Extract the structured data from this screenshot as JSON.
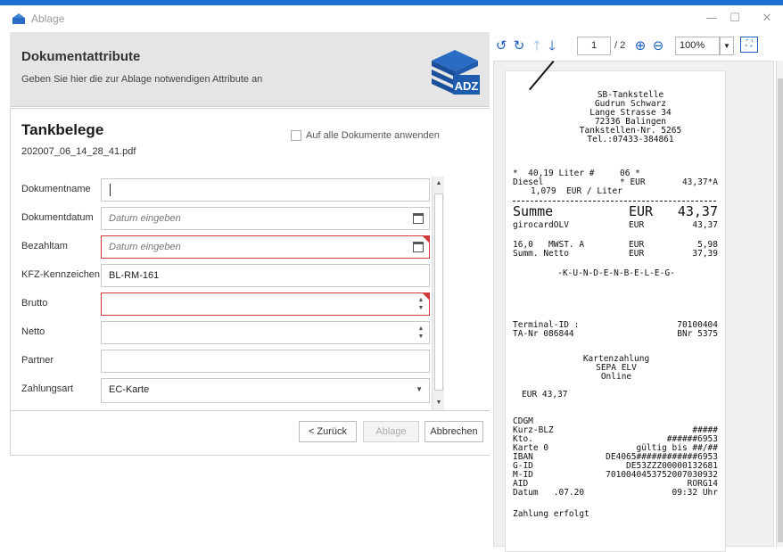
{
  "window": {
    "title": "Ablage",
    "minimize": "—",
    "maximize": "☐",
    "close": "✕"
  },
  "header": {
    "title": "Dokumentattribute",
    "subtitle": "Geben Sie hier die zur Ablage notwendigen Attribute an",
    "logo_text": "ADZ"
  },
  "form": {
    "title": "Tankbelege",
    "filename": "202007_06_14_28_41.pdf",
    "apply_all_label": "Auf alle Dokumente anwenden",
    "fields": [
      {
        "label": "Dokumentname",
        "value": "",
        "placeholder": ""
      },
      {
        "label": "Dokumentdatum",
        "value": "",
        "placeholder": "Datum eingeben"
      },
      {
        "label": "Bezahltam",
        "value": "",
        "placeholder": "Datum eingeben"
      },
      {
        "label": "KFZ-Kennzeichen",
        "value": "BL-RM-161",
        "placeholder": ""
      },
      {
        "label": "Brutto",
        "value": "",
        "placeholder": ""
      },
      {
        "label": "Netto",
        "value": "",
        "placeholder": ""
      },
      {
        "label": "Partner",
        "value": "",
        "placeholder": ""
      },
      {
        "label": "Zahlungsart",
        "value": "EC-Karte",
        "placeholder": ""
      }
    ]
  },
  "buttons": {
    "back": "< Zurück",
    "file": "Ablage",
    "cancel": "Abbrechen"
  },
  "viewer": {
    "page_current": "1",
    "page_total": "/ 2",
    "zoom": "100%",
    "icons": [
      "rotate-left-icon",
      "rotate-right-icon",
      "arrow-up-icon",
      "arrow-down-icon",
      "zoom-in-icon",
      "zoom-out-icon",
      "fit-page-icon"
    ]
  },
  "receipt": {
    "station": "SB-Tankstelle",
    "owner": "Gudrun Schwarz",
    "street": "Lange Strasse 34",
    "city": "72336 Balingen",
    "station_no": "Tankstellen-Nr. 5265",
    "phone": "Tel.:07433-384861",
    "fuel_line1_left": "*  40,19 Liter #",
    "fuel_line1_mid": "06 *",
    "fuel_line2_left": "Diesel",
    "fuel_line2_mid": "* EUR",
    "fuel_line2_right": "43,37*A",
    "fuel_line3": "1,079  EUR / Liter",
    "sum_label": "Summe",
    "sum_cur": "EUR",
    "sum_value": "43,37",
    "giro_label": "girocardOLV",
    "giro_cur": "EUR",
    "giro_value": "43,37",
    "vat_label": "16,0   MWST. A",
    "vat_cur": "EUR",
    "vat_value": "5,98",
    "net_label": "Summ. Netto",
    "net_cur": "EUR",
    "net_value": "37,39",
    "kundenbeleg": "-K-U-N-D-E-N-B-E-L-E-G-",
    "terminal_label": "Terminal-ID :",
    "terminal_value": "70100404",
    "ta_label": "TA-Nr 086844",
    "ta_value": "BNr 5375",
    "pay1": "Kartenzahlung",
    "pay2": "SEPA ELV",
    "pay3": "Online",
    "eur_total": "EUR 43,37",
    "cdgm": "CDGM",
    "kurz_label": "Kurz-BLZ",
    "kurz_value": "#####",
    "kto_label": "Kto.",
    "kto_value": "######6953",
    "karte_label": "Karte 0",
    "karte_value": "gültig bis ##/##",
    "iban_label": "IBAN",
    "iban_value": "DE4065############6953",
    "gid_label": "G-ID",
    "gid_value": "DE53ZZZ00000132681",
    "mid_label": "M-ID",
    "mid_value": "701004045375200703093​2",
    "aid_label": "AID",
    "aid_value": "RORG14",
    "datum_label": "Datum   .07.20",
    "datum_value": "09:32 Uhr",
    "footer": "Zahlung erfolgt"
  }
}
